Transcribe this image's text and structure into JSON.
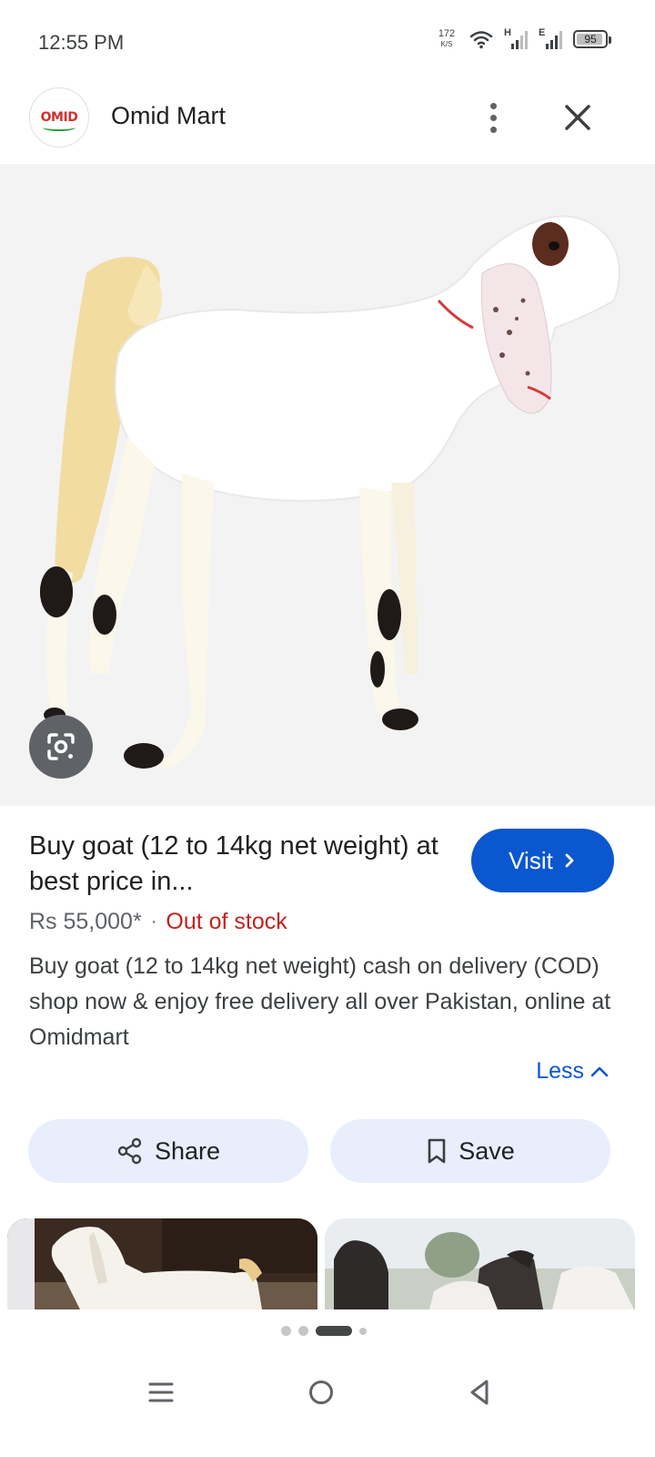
{
  "status_bar": {
    "time": "12:55 PM",
    "net_speed": "172",
    "net_unit": "K/S",
    "signal1_label": "H",
    "signal2_label": "E",
    "battery": "95"
  },
  "header": {
    "logo_text": "OMID",
    "site_name": "Omid Mart"
  },
  "product": {
    "title": "Buy goat (12 to 14kg net weight) at best price in...",
    "visit_label": "Visit",
    "price": "Rs 55,000*",
    "separator": "·",
    "stock_status": "Out of stock",
    "description": "Buy goat (12 to 14kg net weight) cash on delivery (COD) shop now & enjoy free delivery all over Pakistan, online at Omidmart",
    "less_label": "Less"
  },
  "actions": {
    "share_label": "Share",
    "save_label": "Save"
  },
  "colors": {
    "accent": "#0b57d0",
    "out_of_stock": "#c5221f",
    "button_bg": "#e8eefb",
    "image_bg": "#f3f3f3"
  },
  "icons": [
    "wifi-icon",
    "signal-icon",
    "battery-icon",
    "more-vert-icon",
    "close-icon",
    "lens-icon",
    "chevron-right-icon",
    "chevron-up-icon",
    "share-icon",
    "bookmark-icon",
    "menu-icon",
    "home-icon",
    "back-icon"
  ],
  "pager": {
    "pages": 4,
    "active_index": 2
  }
}
